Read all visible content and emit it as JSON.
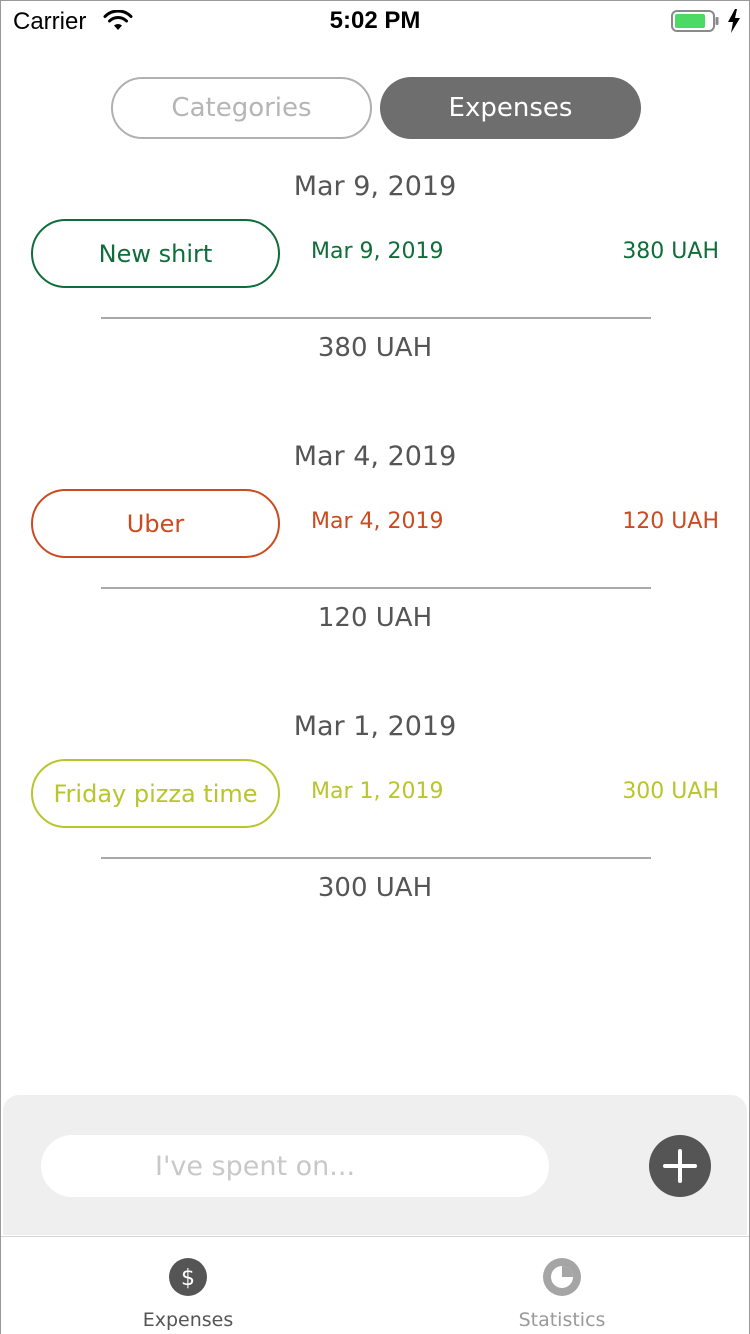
{
  "status_bar": {
    "carrier": "Carrier",
    "time": "5:02 PM",
    "battery_color": "#4cd964"
  },
  "segmented_control": {
    "categories_label": "Categories",
    "expenses_label": "Expenses",
    "selected": "Expenses"
  },
  "groups": [
    {
      "date": "Mar 9, 2019",
      "item": {
        "name": "New shirt",
        "date": "Mar 9, 2019",
        "amount": "380 UAH",
        "color": "#0e6d38"
      },
      "total": "380 UAH"
    },
    {
      "date": "Mar 4, 2019",
      "item": {
        "name": "Uber",
        "date": "Mar 4, 2019",
        "amount": "120 UAH",
        "color": "#c94b1f"
      },
      "total": "120 UAH"
    },
    {
      "date": "Mar 1, 2019",
      "item": {
        "name": "Friday pizza time",
        "date": "Mar 1, 2019",
        "amount": "300 UAH",
        "color": "#b8c52c"
      },
      "total": "300 UAH"
    }
  ],
  "input": {
    "placeholder": "I've spent on...",
    "value": ""
  },
  "tab_bar": {
    "expenses_label": "Expenses",
    "statistics_label": "Statistics",
    "expenses_icon": "dollar-icon",
    "statistics_icon": "pie-chart-icon",
    "selected": "Expenses"
  }
}
